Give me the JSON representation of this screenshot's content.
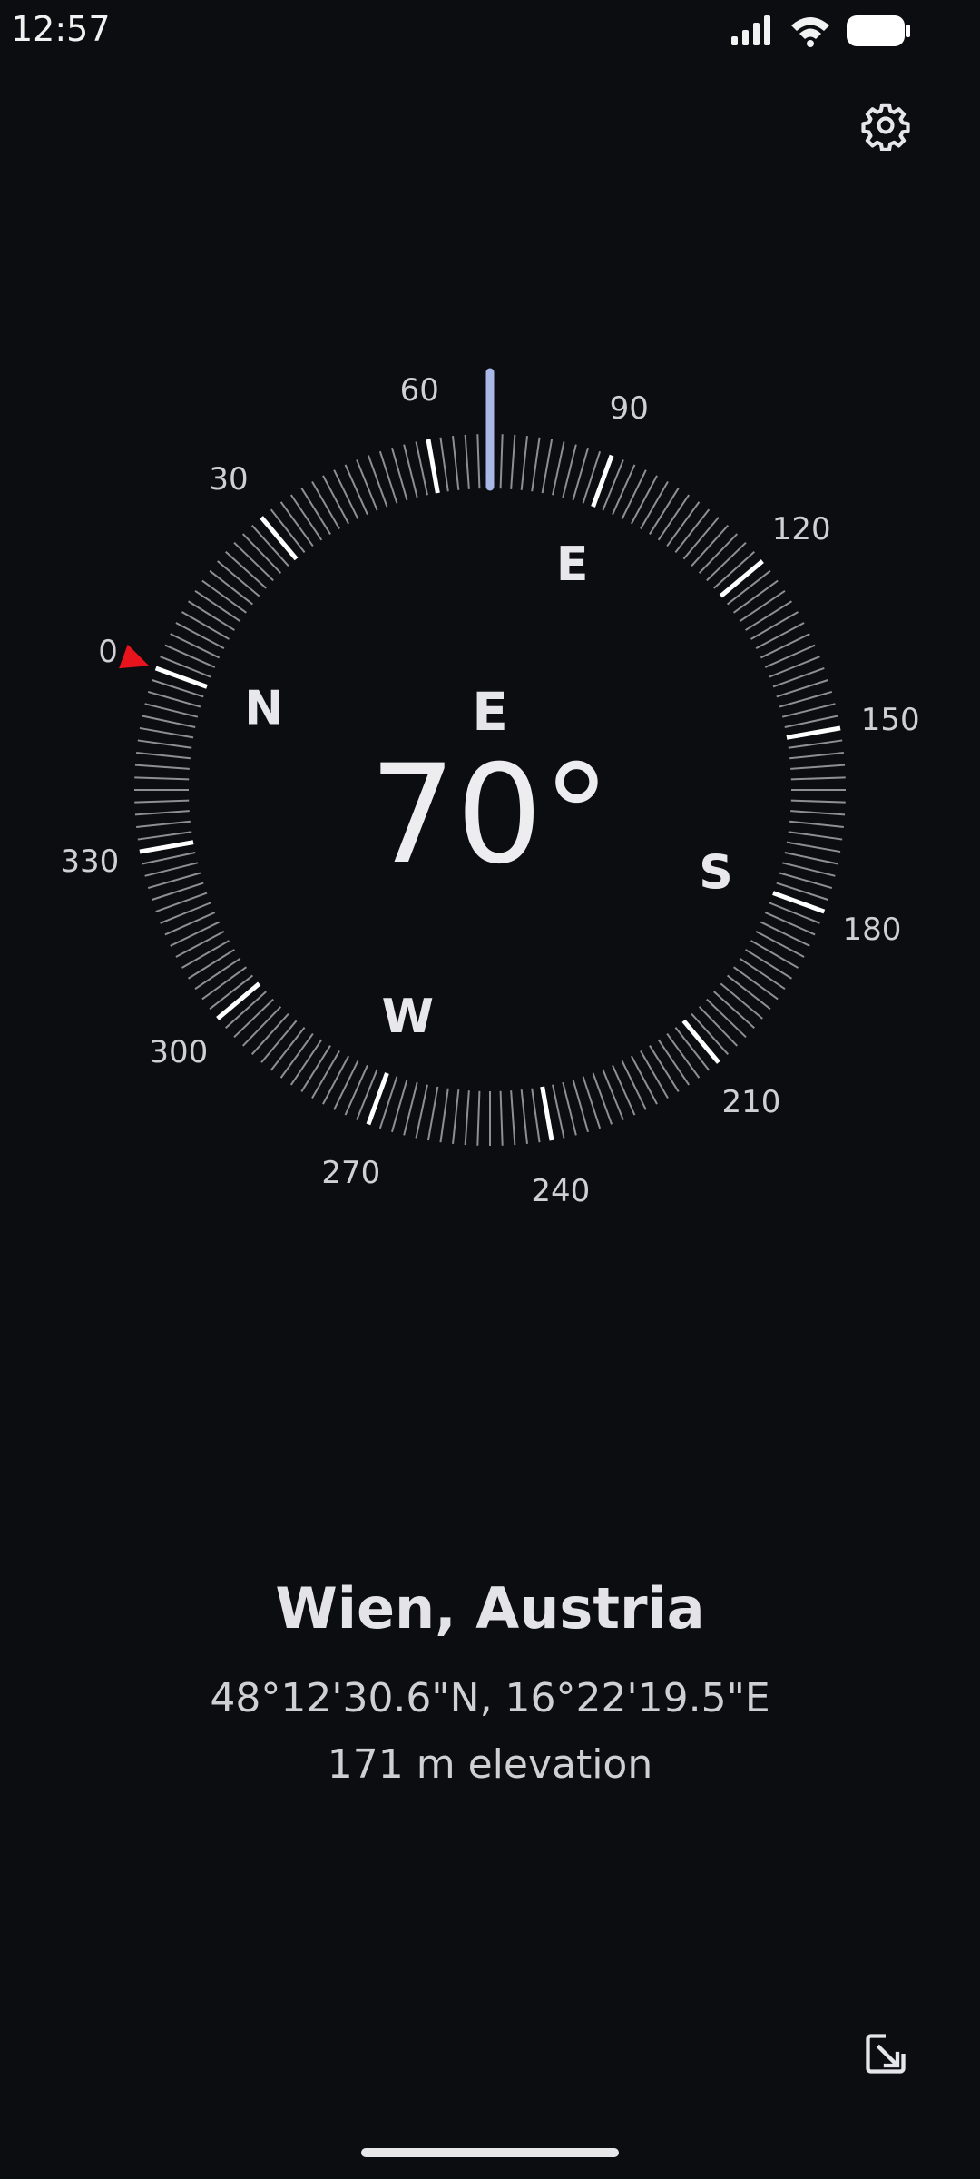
{
  "status_bar": {
    "time": "12:57",
    "icons": [
      "signal-icon",
      "wifi-icon",
      "battery-icon"
    ]
  },
  "toolbar": {
    "settings_icon": "gear-icon"
  },
  "compass": {
    "heading_degrees": 70,
    "heading_direction": "E",
    "heading_display": "70°",
    "degree_labels": [
      "0",
      "30",
      "60",
      "90",
      "120",
      "150",
      "180",
      "210",
      "240",
      "270",
      "300",
      "330"
    ],
    "cardinal_labels": [
      "N",
      "E",
      "S",
      "W"
    ],
    "colors": {
      "pointer": "#a9b8e6",
      "north_marker": "#e8141d",
      "major_tick": "#ffffff",
      "minor_tick": "#8e8e94",
      "label": "#cfcfd4"
    }
  },
  "location": {
    "name": "Wien, Austria",
    "coordinates": "48°12'30.6\"N, 16°22'19.5\"E",
    "elevation": "171 m elevation"
  },
  "footer": {
    "expand_icon": "expand-arrow-icon"
  }
}
